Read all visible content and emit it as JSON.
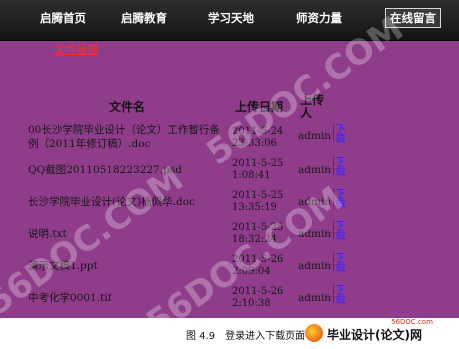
{
  "nav": {
    "items": [
      "启腾首页",
      "启腾教育",
      "学习天地",
      "师资力量",
      "在线留言"
    ]
  },
  "section_title": "文件管理",
  "table": {
    "headers": {
      "name": "文件名",
      "date": "上传日期",
      "user": "上传人"
    },
    "rows": [
      {
        "name": "00长沙学院毕业设计（论文）工作暂行条例（2011年修订稿）.doc",
        "date": "2011-5-24 23:33:06",
        "user": "admin",
        "download": "下载"
      },
      {
        "name": "QQ截图20110518223227.psd",
        "date": "2011-5-25 1:08:41",
        "user": "admin",
        "download": "下载"
      },
      {
        "name": "长沙学院毕业设计(论文)杨佩华.doc",
        "date": "2011-5-25 13:35:19",
        "user": "admin",
        "download": "下载"
      },
      {
        "name": "说明.txt",
        "date": "2011-5-25 18:32:24",
        "user": "admin",
        "download": "下载"
      },
      {
        "name": "演示文稿1.ppt",
        "date": "2011-5-26 2:09:04",
        "user": "admin",
        "download": "下载"
      },
      {
        "name": "中考化学0001.tif",
        "date": "2011-5-26 2:10:38",
        "user": "admin",
        "download": "下载"
      }
    ]
  },
  "caption": "图 4.9　登录进入下载页面",
  "logo": {
    "text": "毕业设计(论文)网",
    "url": "56DOC.com"
  },
  "watermark": "56DOC.COM"
}
